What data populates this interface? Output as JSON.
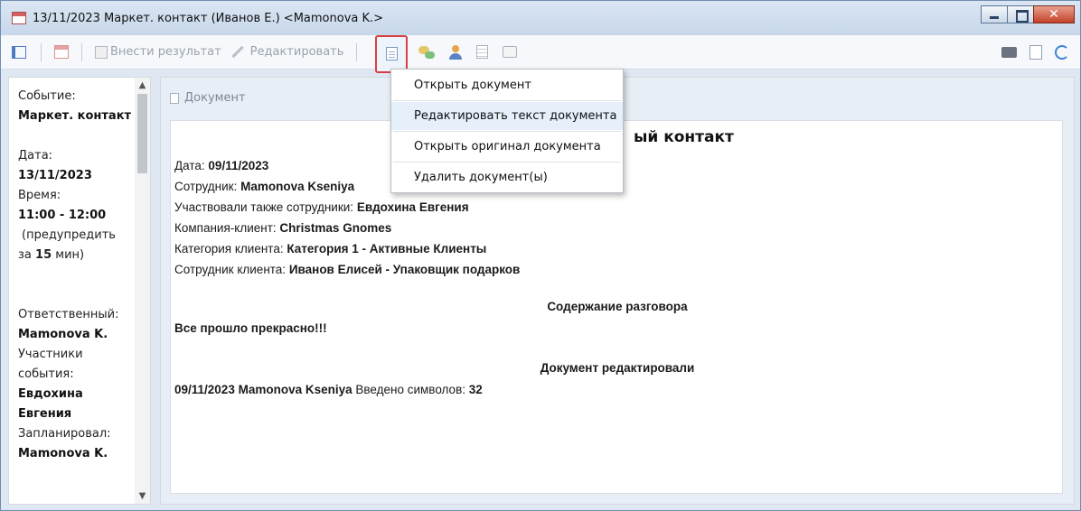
{
  "window": {
    "title": "13/11/2023 Маркет. контакт (Иванов Е.) <Mamonova K.>"
  },
  "toolbar": {
    "enter_result_label": "Внести результат",
    "edit_label": "Редактировать"
  },
  "dropdown_menu": {
    "items": [
      {
        "label": "Открыть документ"
      },
      {
        "label": "Редактировать текст документа"
      },
      {
        "label": "Открыть оригинал документа"
      },
      {
        "label": "Удалить документ(ы)"
      }
    ]
  },
  "sidebar": {
    "event_label": "Событие:",
    "event_value": "Маркет. контакт",
    "date_label": "Дата:",
    "date_value": "13/11/2023",
    "time_label": "Время:",
    "time_value": "11:00 - 12:00",
    "warn_prefix": "(предупредить",
    "warn_za": "за",
    "warn_minutes": "15",
    "warn_suffix": "мин)",
    "responsible_label": "Ответственный:",
    "responsible_value": "Mamonova K.",
    "participants_label_1": "Участники",
    "participants_label_2": "события:",
    "participants_value_1": "Евдохина",
    "participants_value_2": "Евгения",
    "planned_label": "Запланировал:",
    "planned_value": "Mamonova K."
  },
  "panel": {
    "header": "Документ"
  },
  "document": {
    "title_visible": "ый контакт",
    "date_label": "Дата:",
    "date_value": "09/11/2023",
    "employee_label": "Сотрудник:",
    "employee_value": "Mamonova Kseniya",
    "co_label": "Участвовали также сотрудники:",
    "co_value": "Евдохина Евгения",
    "company_label": "Компания-клиент:",
    "company_value": "Christmas Gnomes",
    "category_label": "Категория клиента:",
    "category_value": "Категория 1 - Активные Клиенты",
    "client_emp_label": "Сотрудник клиента:",
    "client_emp_value": "Иванов Елисей - Упаковщик подарков",
    "conversation_heading": "Содержание разговора",
    "conversation_text": "Все прошло прекрасно!!!",
    "edited_heading": "Документ редактировали",
    "edited_entry": "09/11/2023 Mamonova Kseniya",
    "chars_label": "Введено символов:",
    "chars_value": "32"
  }
}
